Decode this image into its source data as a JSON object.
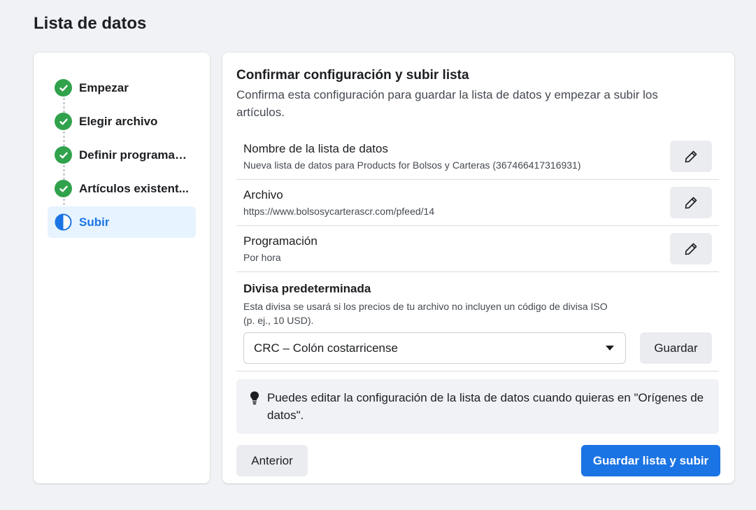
{
  "page": {
    "title": "Lista de datos"
  },
  "stepper": {
    "steps": [
      {
        "label": "Empezar",
        "state": "complete"
      },
      {
        "label": "Elegir archivo",
        "state": "complete"
      },
      {
        "label": "Definir programac...",
        "state": "complete"
      },
      {
        "label": "Artículos existent...",
        "state": "complete"
      },
      {
        "label": "Subir",
        "state": "active"
      }
    ]
  },
  "main": {
    "heading": "Confirmar configuración y subir lista",
    "subtitle": "Confirma esta configuración para guardar la lista de datos y empezar a subir los artículos.",
    "rows": [
      {
        "title": "Nombre de la lista de datos",
        "value": "Nueva lista de datos para Products for Bolsos y Carteras (367466417316931)"
      },
      {
        "title": "Archivo",
        "value": "https://www.bolsosycarterascr.com/pfeed/14"
      },
      {
        "title": "Programación",
        "value": "Por hora"
      }
    ],
    "currency": {
      "title": "Divisa predeterminada",
      "description": "Esta divisa se usará si los precios de tu archivo no incluyen un código de divisa ISO (p. ej., 10 USD).",
      "selected": "CRC – Colón costarricense",
      "save_label": "Guardar"
    },
    "tip": "Puedes editar la configuración de la lista de datos cuando quieras en \"Orígenes de datos\".",
    "footer": {
      "prev_label": "Anterior",
      "submit_label": "Guardar lista y subir"
    }
  },
  "colors": {
    "primary": "#1b74e4",
    "success": "#31a24c",
    "active_bg": "#e7f3ff",
    "page_bg": "#f0f2f5"
  }
}
